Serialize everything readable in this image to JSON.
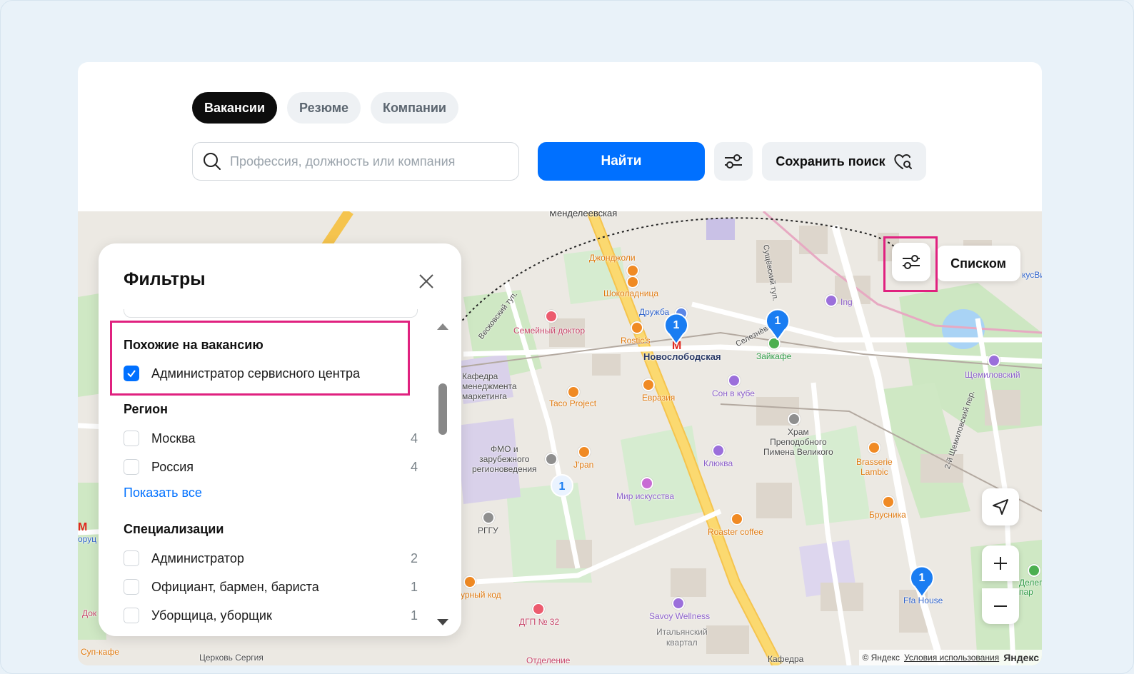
{
  "tabs": [
    {
      "label": "Вакансии",
      "active": true
    },
    {
      "label": "Резюме",
      "active": false
    },
    {
      "label": "Компании",
      "active": false
    }
  ],
  "search": {
    "placeholder": "Профессия, должность или компания",
    "value": "",
    "find_label": "Найти",
    "save_label": "Сохранить поиск"
  },
  "filters": {
    "title": "Фильтры",
    "similar": {
      "title": "Похожие на вакансию",
      "item": {
        "label": "Администратор сервисного центра",
        "checked": true
      }
    },
    "region": {
      "title": "Регион",
      "items": [
        {
          "label": "Москва",
          "count": "4",
          "checked": false
        },
        {
          "label": "Россия",
          "count": "4",
          "checked": false
        }
      ],
      "show_all": "Показать все"
    },
    "specs": {
      "title": "Специализации",
      "items": [
        {
          "label": "Администратор",
          "count": "2",
          "checked": false
        },
        {
          "label": "Официант, бармен, бариста",
          "count": "1",
          "checked": false
        },
        {
          "label": "Уборщица, уборщик",
          "count": "1",
          "checked": false
        }
      ]
    }
  },
  "map": {
    "list_label": "Списком",
    "clusters": [
      "1",
      "1",
      "1",
      "1"
    ],
    "labels": {
      "mendeleevskaya": "Менделеевская",
      "novoslobodskaya": "Новослободская",
      "dzhondzholi": "Джонджоли",
      "shokoladnitsa": "Шоколадница",
      "druzhba": "Дружба",
      "rostics": "Rostic's",
      "semeyny": "Семейный доктор",
      "kafedra": "Кафедра\nменеджмента\nмаркетинга",
      "taco": "Taco Project",
      "evraziya": "Евразия",
      "zaykafe": "Зайкафе",
      "son_v_kube": "Сон в кубе",
      "khram": "Храм\nПреподобного\nПимена Великого",
      "klyukva": "Клюква",
      "fmo": "ФМО и\nзарубежного\nрегионоведения",
      "jpan": "J'pan",
      "mir_iskusstva": "Мир искусства",
      "rggu": "РГГУ",
      "roaster": "Roaster coffee",
      "brasserie": "Brasserie\nLambic",
      "brusnika": "Брусника",
      "shchemilovsky": "Щемиловский",
      "ffa": "Ffa House",
      "savoy": "Savoy Wellness",
      "italyansky": "Итальянский\nквартал",
      "dgp": "ДГП № 32",
      "ing": "Ing",
      "vesk": "Весковский туп.",
      "sushch": "Сущёвский туп.",
      "selez": "Селезнёвская",
      "shchem_per": "2-й Щемиловский пер.",
      "sup_kafe": "Суп-кафе",
      "tserkov": "Церковь Сергия",
      "kafedra2": "Кафедра",
      "otdelenie": "Отделение",
      "kulturny": "урный код",
      "dok": "Док",
      "oruc": "оруц",
      "delegat": "Делегат\nпар",
      "kusvi": "кусВи"
    },
    "attribution": {
      "copyright": "© Яндекс",
      "terms": "Условия использования",
      "brand": "Яндекс"
    }
  }
}
